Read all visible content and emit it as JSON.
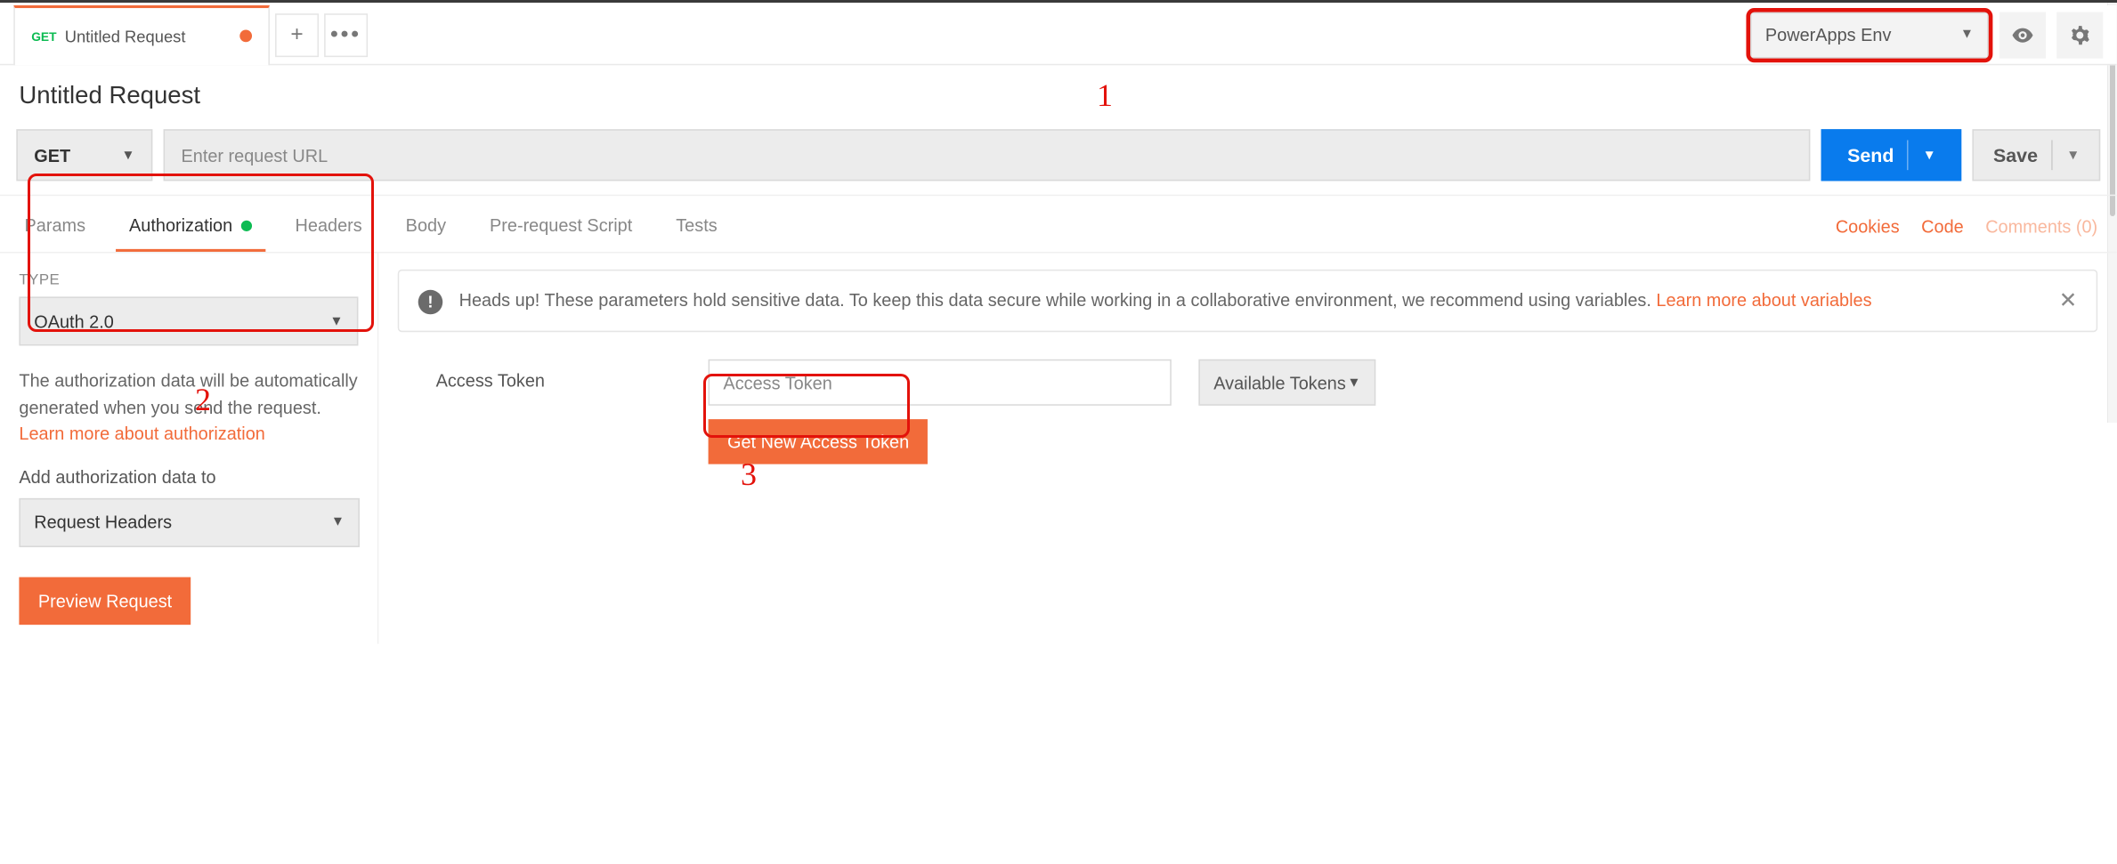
{
  "tab": {
    "method": "GET",
    "title": "Untitled Request"
  },
  "env": {
    "selected": "PowerApps Env"
  },
  "request": {
    "title": "Untitled Request",
    "method": "GET",
    "url_placeholder": "Enter request URL",
    "send": "Send",
    "save": "Save"
  },
  "tabs": {
    "params": "Params",
    "authorization": "Authorization",
    "headers": "Headers",
    "body": "Body",
    "prereq": "Pre-request Script",
    "tests": "Tests"
  },
  "rightLinks": {
    "cookies": "Cookies",
    "code": "Code",
    "comments": "Comments (0)"
  },
  "auth": {
    "typeLabel": "TYPE",
    "typeValue": "OAuth 2.0",
    "desc1": "The authorization data will be automatically generated when you send the request. ",
    "learnAuth": "Learn more about authorization",
    "addTo": "Add authorization data to",
    "addToValue": "Request Headers",
    "preview": "Preview Request"
  },
  "notice": {
    "text": "Heads up! These parameters hold sensitive data. To keep this data secure while working in a collaborative environment, we recommend using variables. ",
    "learn": "Learn more about variables"
  },
  "token": {
    "label": "Access Token",
    "placeholder": "Access Token",
    "getNew": "Get New Access Token",
    "available": "Available Tokens"
  },
  "annot": {
    "n1": "1",
    "n2": "2",
    "n3": "3"
  }
}
